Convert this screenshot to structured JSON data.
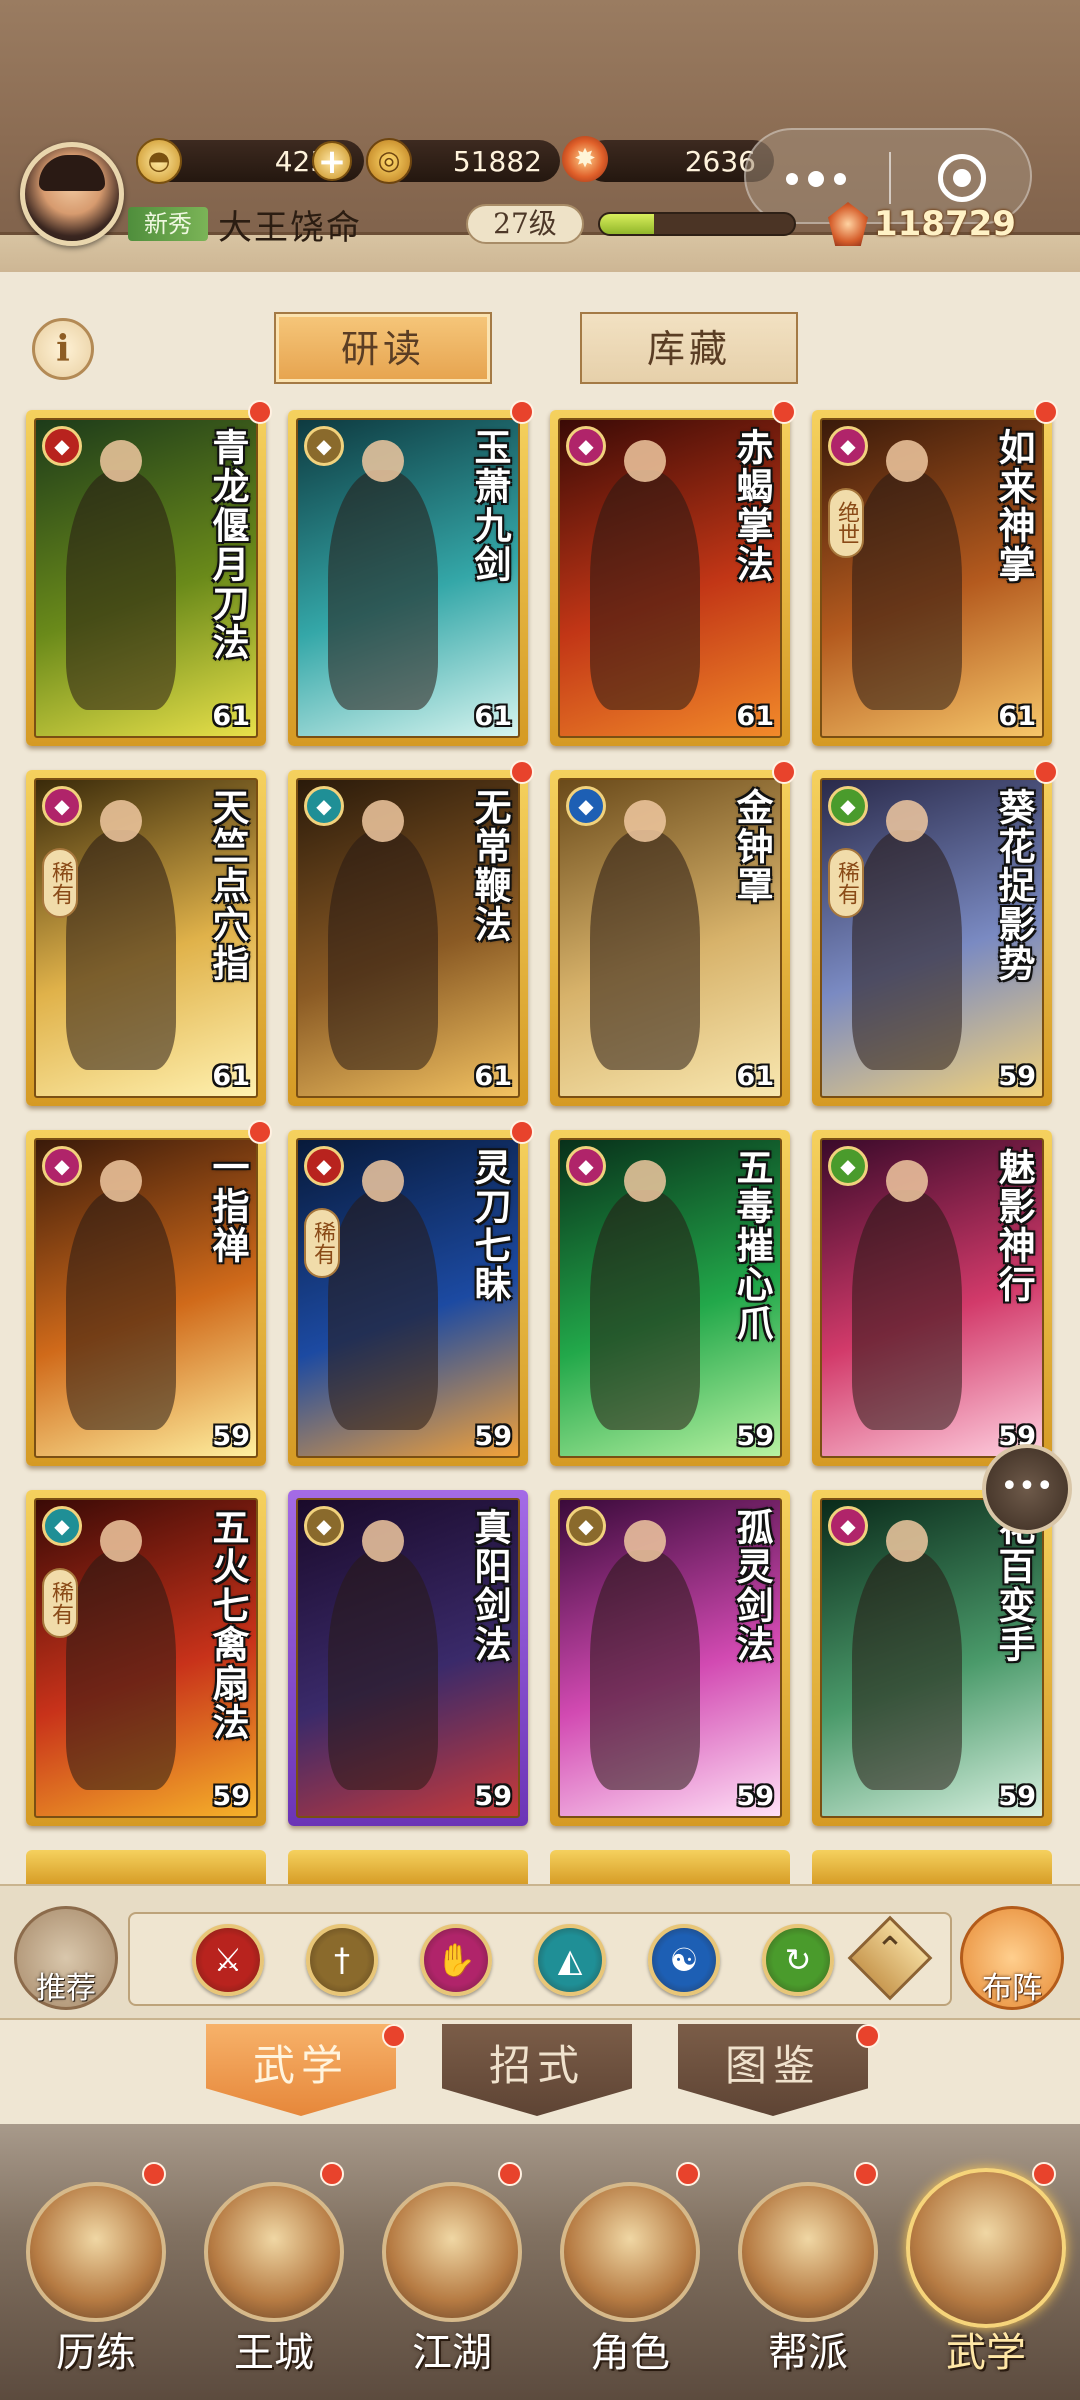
{
  "header": {
    "gold": "4252",
    "coins": "51882",
    "flame": "2636",
    "rank_tag": "新秀",
    "player_name": "大王饶命",
    "level": "27级",
    "exp_fraction": 0.28,
    "power": "118729"
  },
  "top_tabs": [
    {
      "label": "研读",
      "active": true
    },
    {
      "label": "库藏",
      "active": false
    }
  ],
  "cards": [
    {
      "title": "青龙偃月刀法",
      "level": "61",
      "type_color": "#b8231e",
      "type_icon": "blade-icon",
      "badge": "",
      "dot": true
    },
    {
      "title": "玉萧九剑",
      "level": "61",
      "type_color": "#8a6a2c",
      "type_icon": "sword-icon",
      "badge": "",
      "dot": true
    },
    {
      "title": "赤蝎掌法",
      "level": "61",
      "type_color": "#b0246a",
      "type_icon": "palm-icon",
      "badge": "",
      "dot": true
    },
    {
      "title": "如来神掌",
      "level": "61",
      "type_color": "#b0246a",
      "type_icon": "palm-icon",
      "badge": "绝世",
      "dot": true
    },
    {
      "title": "天竺点穴指",
      "level": "61",
      "type_color": "#b0246a",
      "type_icon": "palm-icon",
      "badge": "稀有",
      "dot": false
    },
    {
      "title": "无常鞭法",
      "level": "61",
      "type_color": "#1f8f96",
      "type_icon": "fan-icon",
      "badge": "",
      "dot": true
    },
    {
      "title": "金钟罩",
      "level": "61",
      "type_color": "#1d5fb4",
      "type_icon": "taichi-icon",
      "badge": "",
      "dot": true
    },
    {
      "title": "葵花捉影势",
      "level": "59",
      "type_color": "#4a9b2c",
      "type_icon": "hook-icon",
      "badge": "稀有",
      "dot": true
    },
    {
      "title": "一指禅",
      "level": "59",
      "type_color": "#b0246a",
      "type_icon": "palm-icon",
      "badge": "",
      "dot": true
    },
    {
      "title": "灵刀七眛",
      "level": "59",
      "type_color": "#b8231e",
      "type_icon": "blade-icon",
      "badge": "稀有",
      "dot": true
    },
    {
      "title": "五毒摧心爪",
      "level": "59",
      "type_color": "#b0246a",
      "type_icon": "palm-icon",
      "badge": "",
      "dot": false
    },
    {
      "title": "魅影神行",
      "level": "59",
      "type_color": "#4a9b2c",
      "type_icon": "hook-icon",
      "badge": "",
      "dot": false
    },
    {
      "title": "五火七禽扇法",
      "level": "59",
      "type_color": "#1f8f96",
      "type_icon": "fan-icon",
      "badge": "稀有",
      "dot": false
    },
    {
      "title": "真阳剑法",
      "level": "59",
      "type_color": "#8a6a2c",
      "type_icon": "sword-icon",
      "badge": "",
      "dot": false
    },
    {
      "title": "孤灵剑法",
      "level": "59",
      "type_color": "#8a6a2c",
      "type_icon": "sword-icon",
      "badge": "",
      "dot": false
    },
    {
      "title": "花百变手",
      "level": "59",
      "type_color": "#b0246a",
      "type_icon": "palm-icon",
      "badge": "",
      "dot": false
    }
  ],
  "filter": {
    "recommend_label": "推荐",
    "deploy_label": "布阵",
    "buttons": [
      {
        "icon": "blade-icon",
        "color": "#b8231e",
        "glyph": "⚔"
      },
      {
        "icon": "sword-icon",
        "color": "#8a6a2c",
        "glyph": "†"
      },
      {
        "icon": "palm-icon",
        "color": "#b0246a",
        "glyph": "✋"
      },
      {
        "icon": "fan-icon",
        "color": "#1f8f96",
        "glyph": "◭"
      },
      {
        "icon": "taichi-icon",
        "color": "#1d5fb4",
        "glyph": "☯"
      },
      {
        "icon": "hook-icon",
        "color": "#4a9b2c",
        "glyph": "↻"
      }
    ],
    "arrow_glyph": "⌃"
  },
  "sub_tabs": [
    {
      "label": "武学",
      "active": true
    },
    {
      "label": "招式",
      "active": false
    },
    {
      "label": "图鉴",
      "active": false
    }
  ],
  "bottom_nav": [
    {
      "label": "历练",
      "active": false
    },
    {
      "label": "王城",
      "active": false
    },
    {
      "label": "江湖",
      "active": false
    },
    {
      "label": "角色",
      "active": false
    },
    {
      "label": "帮派",
      "active": false
    },
    {
      "label": "武学",
      "active": true
    }
  ],
  "chat_glyph": "•••"
}
